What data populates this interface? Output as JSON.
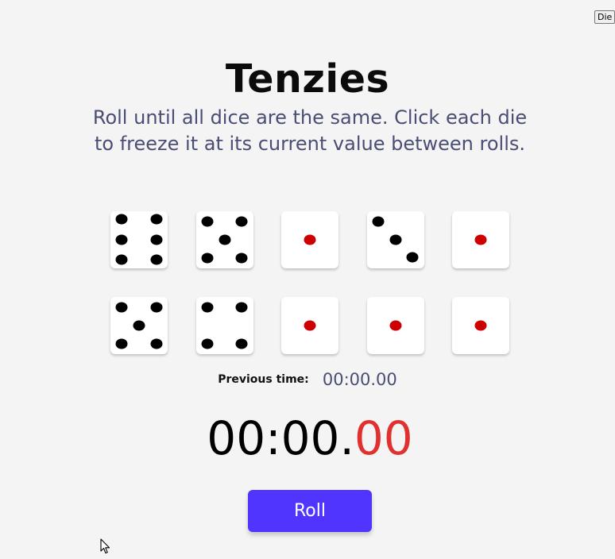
{
  "toggle_button": {
    "label": "Die"
  },
  "header": {
    "title": "Tenzies",
    "instructions": "Roll until all dice are the same. Click each die to freeze it at its current value between rolls."
  },
  "colors": {
    "pip": "#000000",
    "held_pip": "#cc0000",
    "button": "#5035ff",
    "timer_ms": "#e03030"
  },
  "dice": [
    {
      "value": 6,
      "held": false
    },
    {
      "value": 5,
      "held": false
    },
    {
      "value": 1,
      "held": true
    },
    {
      "value": 3,
      "held": false
    },
    {
      "value": 1,
      "held": true
    },
    {
      "value": 5,
      "held": false
    },
    {
      "value": 4,
      "held": false
    },
    {
      "value": 1,
      "held": true
    },
    {
      "value": 1,
      "held": true
    },
    {
      "value": 1,
      "held": true
    }
  ],
  "timer": {
    "previous_label": "Previous time:",
    "previous_value": "00:00.00",
    "current_main": "00:00.",
    "current_ms": "00"
  },
  "roll_button": {
    "label": "Roll"
  }
}
